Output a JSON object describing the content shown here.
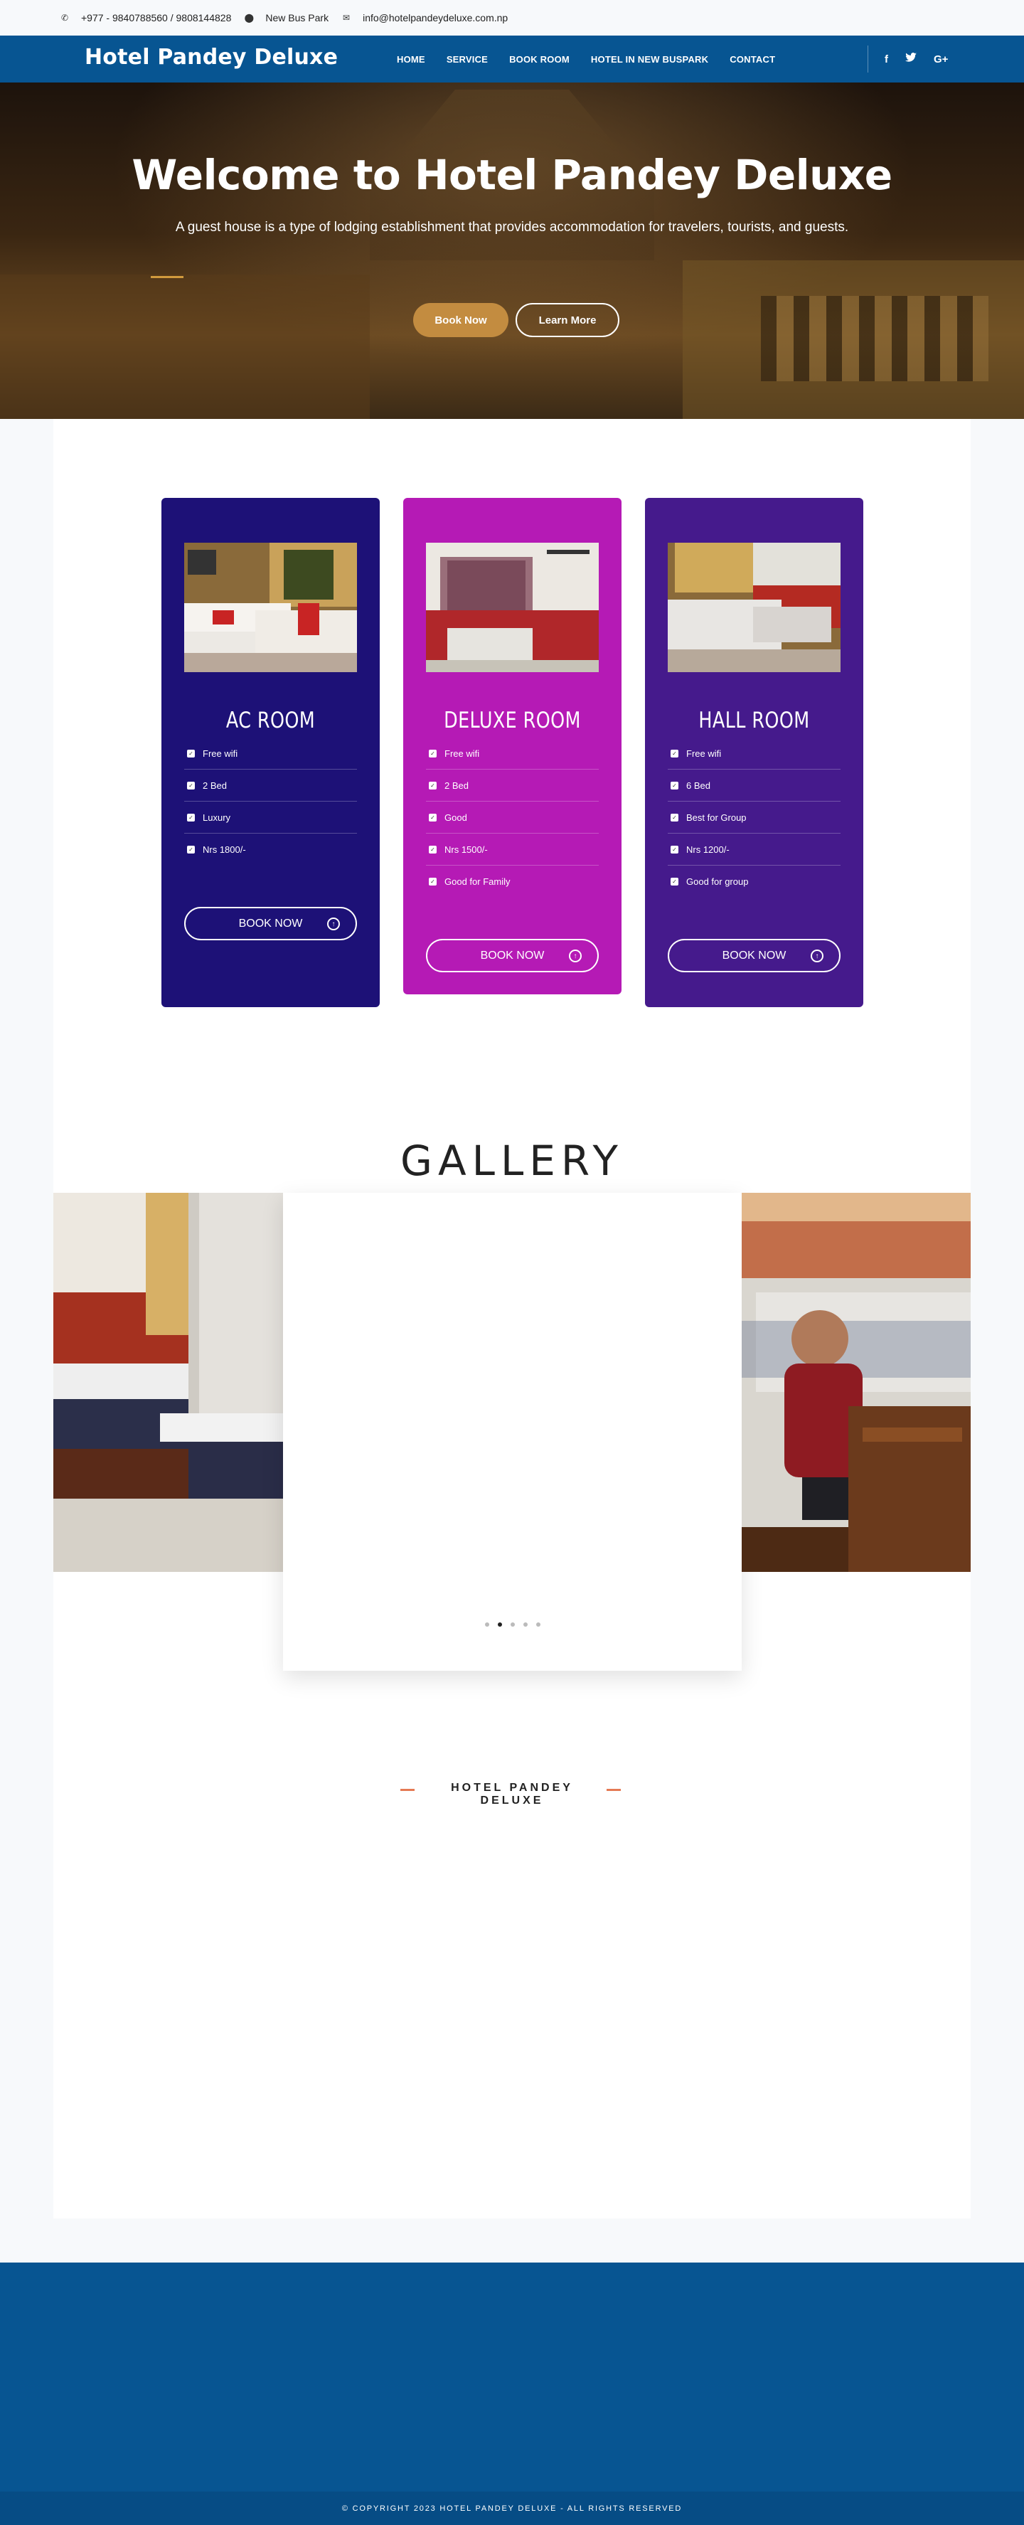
{
  "topbar": {
    "phone": "+977 - 9840788560 / 9808144828",
    "location": "New Bus Park",
    "email": "info@hotelpandeydeluxe.com.np",
    "phone_icon": "phone-icon",
    "location_icon": "map-marker-icon",
    "email_icon": "envelope-icon"
  },
  "nav": {
    "brand": "Hotel Pandey Deluxe",
    "menu": [
      "HOME",
      "SERVICE",
      "BOOK ROOM",
      "HOTEL IN NEW BUSPARK",
      "CONTACT"
    ],
    "social": [
      "f",
      "t",
      "G+"
    ]
  },
  "hero": {
    "title": "Welcome to Hotel Pandey Deluxe",
    "subtitle": "A guest house is a type of lodging establishment that provides accommodation for travelers, tourists, and guests.",
    "book_label": "Book Now",
    "learn_label": "Learn More"
  },
  "rooms": [
    {
      "name": "AC ROOM",
      "color": "#1d1177",
      "features": [
        "Free wifi",
        "2 Bed",
        "Luxury",
        "Nrs 1800/-"
      ],
      "button": "BOOK NOW"
    },
    {
      "name": "DELUXE ROOM",
      "color": "#b51ab5",
      "features": [
        "Free wifi",
        "2 Bed",
        "Good",
        "Nrs 1500/-",
        "Good for Family"
      ],
      "button": "BOOK NOW"
    },
    {
      "name": "HALL ROOM",
      "color": "#451a8c",
      "features": [
        "Free wifi",
        "6 Bed",
        "Best for Group",
        "Nrs 1200/-",
        "Good for group"
      ],
      "button": "BOOK NOW"
    }
  ],
  "gallery": {
    "title": "GALLERY"
  },
  "hotel_section": {
    "title": "HOTEL PANDEY DELUXE"
  },
  "footer": {
    "copyright": "© COPYRIGHT 2023 HOTEL PANDEY DELUXE - ALL RIGHTS RESERVED"
  }
}
